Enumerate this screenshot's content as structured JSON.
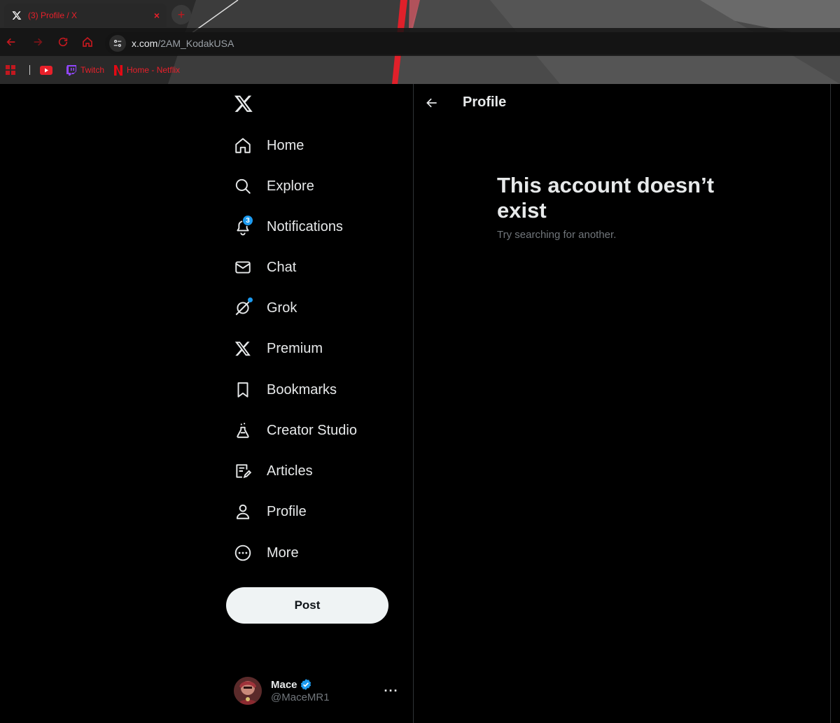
{
  "browser": {
    "tab_title": "(3) Profile / X",
    "tab_close": "×",
    "new_tab": "+",
    "url_host": "x.com",
    "url_path": "/2AM_KodakUSA",
    "bookmarks": [
      {
        "label": ""
      },
      {
        "label": ""
      },
      {
        "label": "Twitch"
      },
      {
        "label": "Home - Netflix"
      }
    ]
  },
  "sidebar": {
    "items": [
      {
        "label": "Home",
        "icon": "home-icon"
      },
      {
        "label": "Explore",
        "icon": "search-icon"
      },
      {
        "label": "Notifications",
        "icon": "bell-icon",
        "badge": "3"
      },
      {
        "label": "Chat",
        "icon": "mail-icon"
      },
      {
        "label": "Grok",
        "icon": "grok-icon"
      },
      {
        "label": "Premium",
        "icon": "x-logo-icon"
      },
      {
        "label": "Bookmarks",
        "icon": "bookmark-icon"
      },
      {
        "label": "Creator Studio",
        "icon": "flask-icon"
      },
      {
        "label": "Articles",
        "icon": "article-icon"
      },
      {
        "label": "Profile",
        "icon": "person-icon"
      },
      {
        "label": "More",
        "icon": "more-circle-icon"
      }
    ],
    "post_label": "Post",
    "account": {
      "name": "Mace",
      "handle": "@MaceMR1",
      "more": "···"
    }
  },
  "main": {
    "header_title": "Profile",
    "empty_title": "This account doesn’t exist",
    "empty_subtitle": "Try searching for another."
  },
  "colors": {
    "accent": "#1d9bf0",
    "browser_red": "#e8202a",
    "post_bg": "#eff3f4"
  }
}
